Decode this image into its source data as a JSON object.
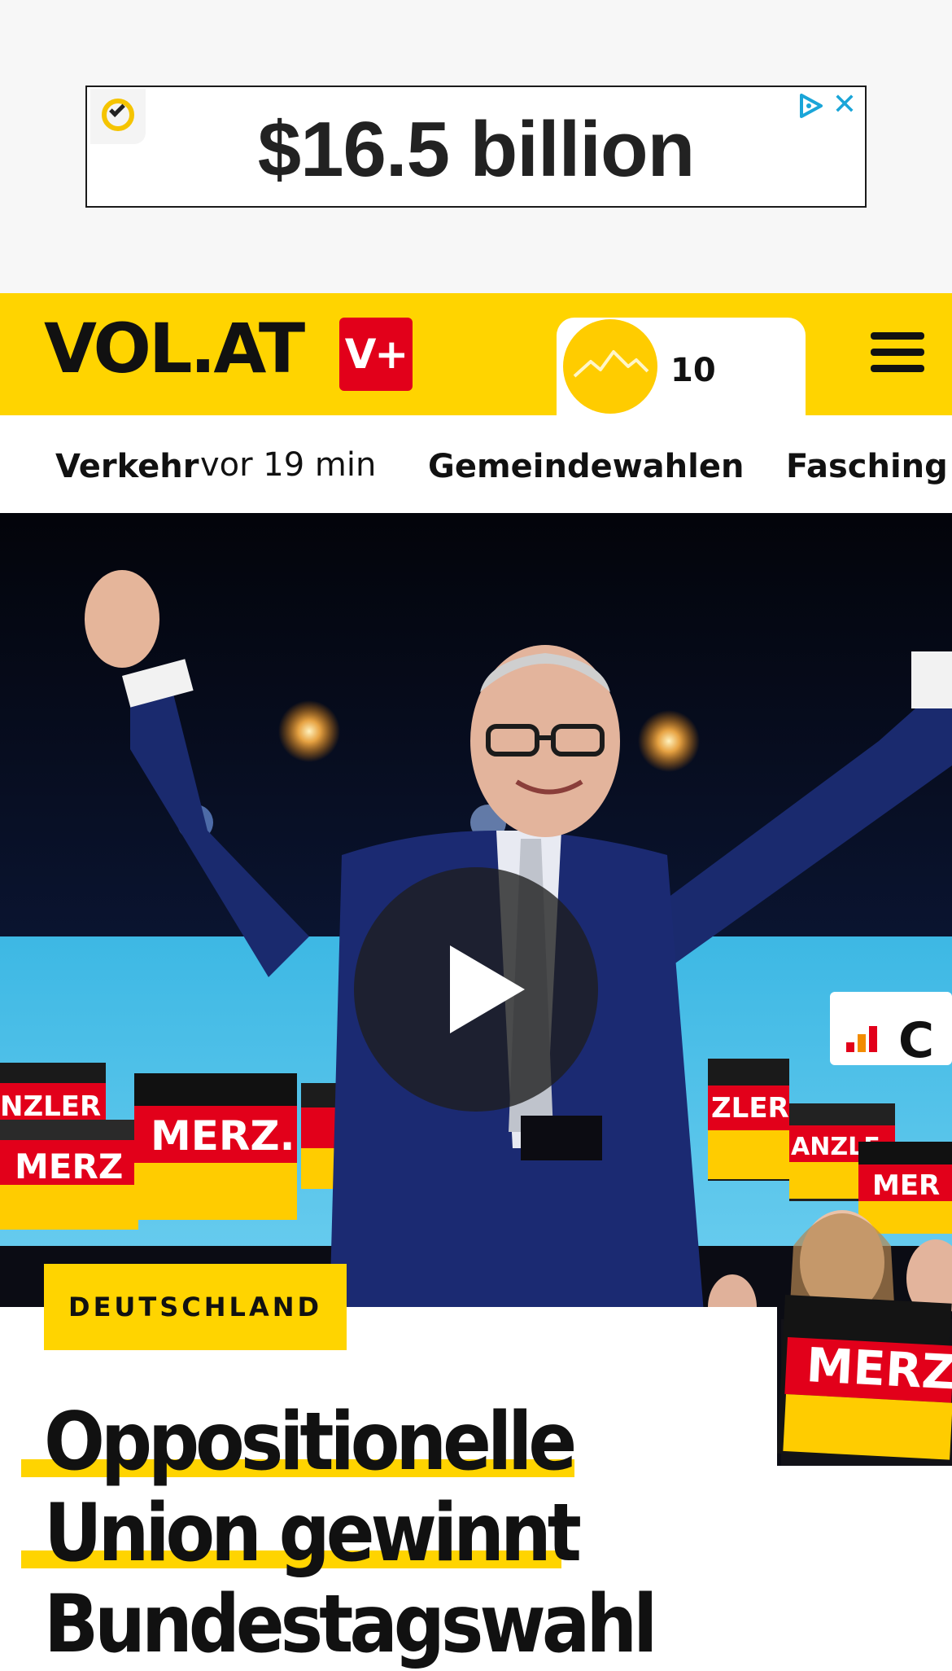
{
  "ad": {
    "text": "$16.5 billion",
    "badge_icon": "check-badge-icon",
    "choices_icon": "ad-choices-icon",
    "close_label": "✕"
  },
  "header": {
    "logo": "VOL.AT",
    "plus_badge": "V+",
    "weather_temp": "10",
    "weather_icon": "sun-mountains-icon",
    "menu_icon": "hamburger-menu-icon",
    "brand_color": "#ffd400",
    "plus_color": "#e2001a"
  },
  "subnav": {
    "items": [
      {
        "label": "Verkehr",
        "meta": "vor 19 min"
      },
      {
        "label": "Gemeindewahlen"
      },
      {
        "label": "Fasching"
      }
    ]
  },
  "hero": {
    "play_icon": "play-icon",
    "placard_text": "MERZ.",
    "placard_text_2": "NZLER",
    "placard_text_3": "ZLER.",
    "placard_text_4": "ANZLE",
    "logo_text": "C"
  },
  "article": {
    "category": "DEUTSCHLAND",
    "headline_lines": [
      "Oppositionelle",
      "Union gewinnt",
      "Bundestagswahl"
    ]
  }
}
